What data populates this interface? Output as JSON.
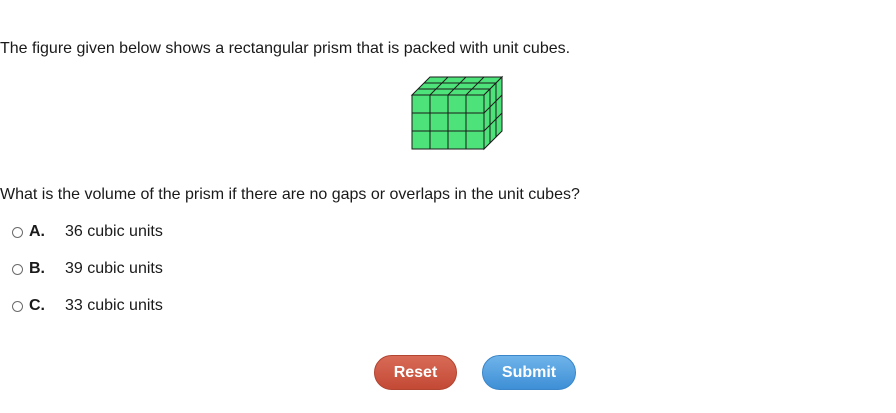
{
  "question": {
    "intro": "The figure given below shows a rectangular prism that is packed with unit cubes.",
    "prompt": "What is the volume of the prism if there are no gaps or overlaps in the unit cubes?"
  },
  "figure": {
    "cube_fill": "#4de37a",
    "edge_color": "#1a1a1a",
    "front_columns": 4,
    "front_rows": 3,
    "depth_layers": 3
  },
  "choices": [
    {
      "letter": "A.",
      "text": "36 cubic units"
    },
    {
      "letter": "B.",
      "text": "39 cubic units"
    },
    {
      "letter": "C.",
      "text": "33 cubic units"
    }
  ],
  "buttons": {
    "reset_label": "Reset",
    "submit_label": "Submit",
    "reset_color": "#c8513c",
    "submit_color": "#4a9ae0"
  }
}
